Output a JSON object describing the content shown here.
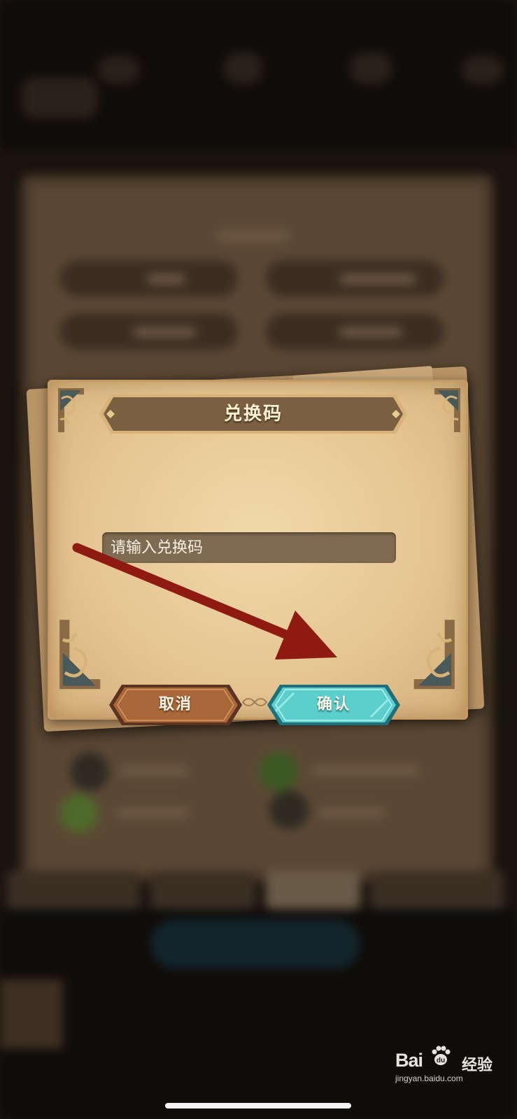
{
  "dialog": {
    "title": "兑换码",
    "input_placeholder": "请输入兑换码",
    "input_value": "",
    "cancel_label": "取消",
    "confirm_label": "确认"
  },
  "watermark": {
    "brand_left": "Bai",
    "brand_paw": "du",
    "brand_right": "经验",
    "url": "jingyan.baidu.com"
  },
  "colors": {
    "parchment": "#e6c693",
    "title_bar": "#7a5f40",
    "input_bg": "#7f6a52",
    "cancel_button": "#a9683a",
    "confirm_button": "#5ccfcc",
    "annotation_arrow": "#8f1a12"
  },
  "icons": {
    "annotation": "red-arrow-icon",
    "corner": "celtic-knot-corner-icon"
  }
}
